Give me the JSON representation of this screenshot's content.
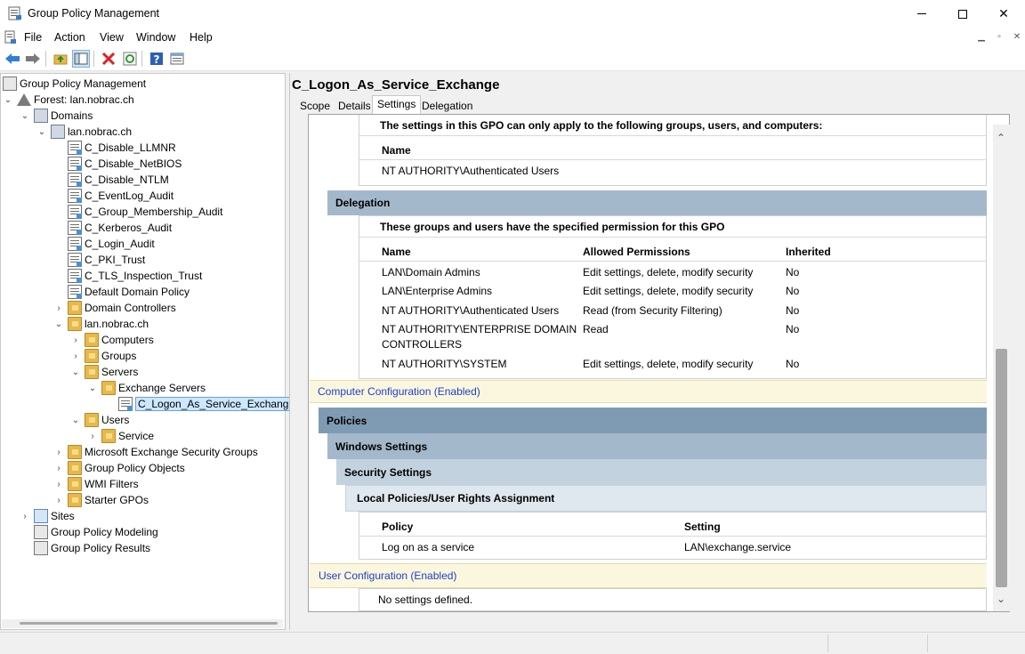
{
  "window": {
    "title": "Group Policy Management",
    "minimize_label": "—",
    "maximize_label": "☐",
    "close_label": "✕"
  },
  "menu": {
    "items": [
      "File",
      "Action",
      "View",
      "Window",
      "Help"
    ]
  },
  "toolbar": {
    "buttons": [
      "back-arrow-icon",
      "forward-arrow-icon",
      "up-folder-icon",
      "show-hide-tree-icon",
      "delete-icon",
      "refresh-icon",
      "help-icon",
      "properties-icon"
    ]
  },
  "tree": {
    "root": "Group Policy Management",
    "forest": "Forest: lan.nobrac.ch",
    "domains": "Domains",
    "domain": "lan.nobrac.ch",
    "linked_gpos": [
      "C_Disable_LLMNR",
      "C_Disable_NetBIOS",
      "C_Disable_NTLM",
      "C_EventLog_Audit",
      "C_Group_Membership_Audit",
      "C_Kerberos_Audit",
      "C_Login_Audit",
      "C_PKI_Trust",
      "C_TLS_Inspection_Trust",
      "Default Domain Policy"
    ],
    "domain_controllers": "Domain Controllers",
    "ou_root": "lan.nobrac.ch",
    "computers": "Computers",
    "groups": "Groups",
    "servers": "Servers",
    "exchange_servers": "Exchange Servers",
    "selected_gpo": "C_Logon_As_Service_Exchange",
    "users": "Users",
    "service": "Service",
    "ms_exchange_groups": "Microsoft Exchange Security Groups",
    "group_policy_objects": "Group Policy Objects",
    "wmi_filters": "WMI Filters",
    "starter_gpos": "Starter GPOs",
    "sites": "Sites",
    "modeling": "Group Policy Modeling",
    "results": "Group Policy Results"
  },
  "detail": {
    "title": "C_Logon_As_Service_Exchange",
    "tabs": [
      "Scope",
      "Details",
      "Settings",
      "Delegation"
    ],
    "active_tab": "Settings"
  },
  "report": {
    "security_filter_note": "The settings in this GPO can only apply to the following groups, users, and computers:",
    "security_name_header": "Name",
    "security_name_value": "NT AUTHORITY\\Authenticated Users",
    "delegation_heading": "Delegation",
    "delegation_note": "These groups and users have the specified permission for this GPO",
    "delegation_headers": [
      "Name",
      "Allowed Permissions",
      "Inherited"
    ],
    "delegation_rows": [
      {
        "name": "LAN\\Domain Admins",
        "perm": "Edit settings, delete, modify security",
        "inh": "No"
      },
      {
        "name": "LAN\\Enterprise Admins",
        "perm": "Edit settings, delete, modify security",
        "inh": "No"
      },
      {
        "name": "NT AUTHORITY\\Authenticated Users",
        "perm": "Read (from Security Filtering)",
        "inh": "No"
      },
      {
        "name": "NT AUTHORITY\\ENTERPRISE DOMAIN",
        "name2": "CONTROLLERS",
        "perm": "Read",
        "inh": "No"
      },
      {
        "name": "NT AUTHORITY\\SYSTEM",
        "perm": "Edit settings, delete, modify security",
        "inh": "No"
      }
    ],
    "computer_config": "Computer Configuration (Enabled)",
    "policies": "Policies",
    "windows_settings": "Windows Settings",
    "security_settings": "Security Settings",
    "local_policies": "Local Policies/User Rights Assignment",
    "policy_headers": [
      "Policy",
      "Setting"
    ],
    "policy_row": {
      "policy": "Log on as a service",
      "setting": "LAN\\exchange.service"
    },
    "user_config": "User Configuration (Enabled)",
    "no_settings": "No settings defined."
  },
  "colors": {
    "policies_bar": "#7f9bb4",
    "windows_bar": "#a3b8cb",
    "security_bar": "#c3d2df",
    "local_bar": "#dfe7ef",
    "delegation_bar": "#a3b8cb",
    "config_bar": "#fbf7df",
    "config_text": "#1e3ec8",
    "selection": "#cce8ff"
  }
}
